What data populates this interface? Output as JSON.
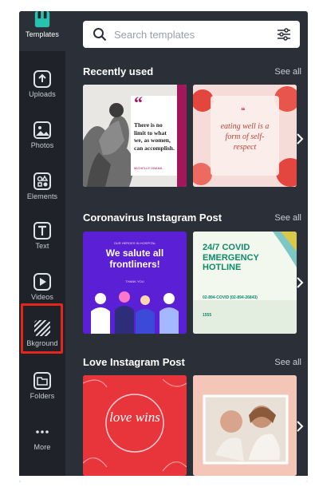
{
  "sidebar": {
    "items": [
      {
        "label": "Templates",
        "icon": "templates-icon"
      },
      {
        "label": "Uploads",
        "icon": "upload-cloud-icon"
      },
      {
        "label": "Photos",
        "icon": "photo-icon"
      },
      {
        "label": "Elements",
        "icon": "shapes-icon"
      },
      {
        "label": "Text",
        "icon": "text-icon"
      },
      {
        "label": "Videos",
        "icon": "play-icon"
      },
      {
        "label": "Bkground",
        "icon": "hatched-background-icon"
      },
      {
        "label": "Folders",
        "icon": "folder-icon"
      },
      {
        "label": "More",
        "icon": "more-dots-icon"
      }
    ]
  },
  "search": {
    "placeholder": "Search templates"
  },
  "sections": [
    {
      "title": "Recently used",
      "see_all": "See all"
    },
    {
      "title": "Coronavirus Instagram Post",
      "see_all": "See all"
    },
    {
      "title": "Love Instagram Post",
      "see_all": "See all"
    }
  ],
  "cards": {
    "quote": {
      "mark": "“",
      "text": "There is no limit to what we, as women, can accomplish.",
      "credit": "MICHELLE OBAMA"
    },
    "script": {
      "text": "eating well is a form of self-respect"
    },
    "salute": {
      "text": "We salute all frontliners!",
      "small": "OUR HEROES IN HOSPITAL",
      "tag": "THANK YOU"
    },
    "covid": {
      "title": "24/7 COVID EMERGENCY HOTLINE",
      "line1": "02-894-COVID (02-894-26843)",
      "line2": "1555"
    },
    "love": {
      "text": "love wins"
    }
  },
  "colors": {
    "panel": "#2b2f38",
    "sidebar": "#1f2228",
    "highlight": "#e4261b",
    "purple": "#5b1fd6"
  }
}
